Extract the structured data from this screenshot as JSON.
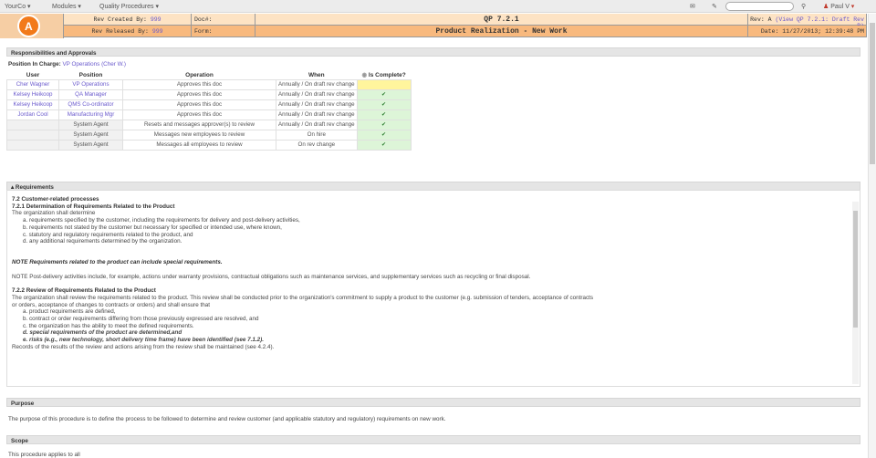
{
  "nav": {
    "brand": "YourCo",
    "modules": "Modules",
    "quality": "Quality Procedures",
    "user": "Paul V"
  },
  "header": {
    "created_label": "Rev Created By:",
    "created_val": "999",
    "released_label": "Rev Released By:",
    "released_val": "999",
    "doc_label": "Doc#:",
    "doc_num": "QP 7.2.1",
    "form_label": "Form:",
    "doc_title": "Product Realization - New Work",
    "rev_label": "Rev: A",
    "rev_link": "(View QP 7.2.1: Draft Rev B)",
    "date": "Date: 11/27/2013; 12:39:48 PM"
  },
  "resp": {
    "title": "Responsibilities and Approvals",
    "pic_label": "Position In Charge:",
    "pic_value": "VP Operations (Cher W.)",
    "headers": [
      "User",
      "Position",
      "Operation",
      "When",
      "Is Complete?"
    ],
    "rows": [
      {
        "user": "Cher Wagner",
        "position": "VP Operations",
        "op": "Approves this doc",
        "when": "Annually / On draft rev change",
        "done": ""
      },
      {
        "user": "Kelsey Heikoop",
        "position": "QA Manager",
        "op": "Approves this doc",
        "when": "Annually / On draft rev change",
        "done": "✔"
      },
      {
        "user": "Kelsey Heikoop",
        "position": "QMS Co-ordinator",
        "op": "Approves this doc",
        "when": "Annually / On draft rev change",
        "done": "✔"
      },
      {
        "user": "Jordan Cool",
        "position": "Manufacturing Mgr",
        "op": "Approves this doc",
        "when": "Annually / On draft rev change",
        "done": "✔"
      },
      {
        "user": "",
        "position": "System Agent",
        "op": "Resets and messages approver(s) to review",
        "when": "Annually / On draft rev change",
        "done": "✔"
      },
      {
        "user": "",
        "position": "System Agent",
        "op": "Messages new employees to review",
        "when": "On hire",
        "done": "✔"
      },
      {
        "user": "",
        "position": "System Agent",
        "op": "Messages all employees to review",
        "when": "On rev change",
        "done": "✔"
      }
    ]
  },
  "req": {
    "title": "Requirements",
    "h1": "7.2 Customer-related processes",
    "h2": "7.2.1 Determination of Requirements Related to the Product",
    "p1": "The organization shall determine",
    "l1": [
      "a. requirements specified by the customer, including the requirements for delivery and post-delivery activities,",
      "b. requirements not stated by the customer but necessary for specified or intended use, where known,",
      "c. statutory and regulatory requirements related to the product, and",
      "d. any additional requirements determined by the organization."
    ],
    "note1": "NOTE Requirements related to the product can include special requirements.",
    "note2": "NOTE Post-delivery activities include, for example, actions under warranty provisions, contractual obligations such as maintenance services, and supplementary services such as recycling or final disposal.",
    "h3": "7.2.2 Review of Requirements Related to the Product",
    "p2": "The organization shall review the requirements related to the product. This review shall be conducted prior to the organization's commitment to supply a product to the customer (e.g. submission of tenders, acceptance of contracts",
    "p3": "or orders, acceptance of changes to contracts or orders) and shall ensure that",
    "l2": [
      "a. product requirements are defined,",
      "b. contract or order requirements differing from those previously expressed are resolved, and",
      "c. the organization has the ability to meet the defined requirements."
    ],
    "l3": [
      "d. special requirements of the product are determined,and",
      "e. risks (e.g., new technology, short delivery time frame) have been identified (see 7.1.2)."
    ],
    "p4": "Records of the results of the review and actions arising from the review shall be maintained (see 4.2.4)."
  },
  "purpose": {
    "title": "Purpose",
    "text": "The purpose of this procedure is to define the process to be followed to determine and review customer (and applicable statutory and regulatory) requirements on new work."
  },
  "scope": {
    "title": "Scope",
    "text": "This procedure applies to all"
  }
}
